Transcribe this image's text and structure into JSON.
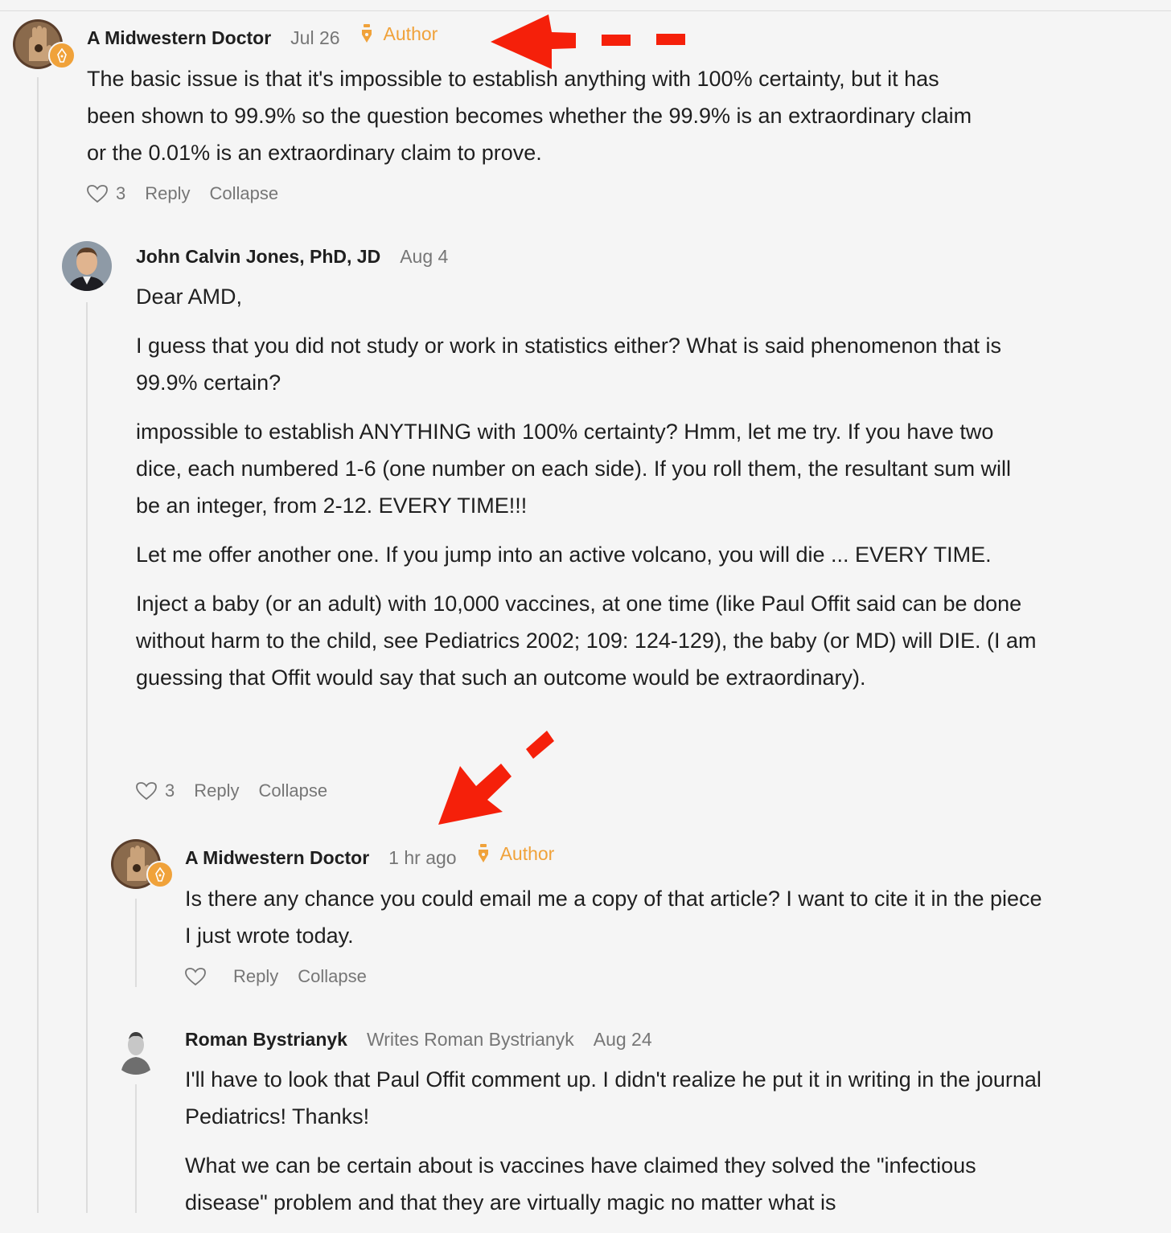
{
  "comments": [
    {
      "name": "A Midwestern Doctor",
      "date": "Jul 26",
      "author_label": "Author",
      "paragraphs": [
        "The basic issue is that it's impossible to establish anything with 100% certainty, but it has been shown to 99.9% so the question becomes whether the 99.9% is an extraordinary claim or the 0.01% is an extraordinary claim to prove."
      ],
      "likes": "3",
      "reply_label": "Reply",
      "collapse_label": "Collapse"
    },
    {
      "name": "John Calvin Jones, PhD, JD",
      "date": "Aug 4",
      "paragraphs": [
        "Dear AMD,",
        "I guess that you did not study or work in statistics either? What is said phenomenon that is 99.9% certain?",
        "impossible to establish ANYTHING with 100% certainty? Hmm, let me try. If you have two dice, each numbered 1-6 (one number on each side). If you roll them, the resultant sum will be an integer, from 2-12. EVERY TIME!!!",
        "Let me offer another one. If you jump into an active volcano, you will die ... EVERY TIME.",
        "Inject a baby (or an adult) with 10,000 vaccines, at one time (like Paul Offit said can be done without harm to the child, see Pediatrics 2002; 109: 124-129), the baby (or MD) will DIE. (I am guessing that Offit would say that such an outcome would be extraordinary)."
      ],
      "likes": "3",
      "reply_label": "Reply",
      "collapse_label": "Collapse"
    },
    {
      "name": "A Midwestern Doctor",
      "date": "1 hr ago",
      "author_label": "Author",
      "paragraphs": [
        "Is there any chance you could email me a copy of that article? I want to cite it in the piece I just wrote today."
      ],
      "likes": "",
      "reply_label": "Reply",
      "collapse_label": "Collapse"
    },
    {
      "name": "Roman Bystrianyk",
      "writes": "Writes Roman Bystrianyk",
      "date": "Aug 24",
      "paragraphs": [
        "I'll have to look that Paul Offit comment up. I didn't realize he put it in writing in the journal Pediatrics! Thanks!",
        "What we can be certain about is vaccines have claimed they solved the \"infectious disease\" problem and that they are virtually magic no matter what is"
      ]
    }
  ],
  "colors": {
    "accent": "#f0a23a",
    "arrow": "#f5200a",
    "muted": "#767676",
    "background": "#f5f5f5"
  },
  "icons": [
    "heart-icon",
    "pen-nib-icon",
    "author-badge-icon",
    "arrow-annotation"
  ]
}
